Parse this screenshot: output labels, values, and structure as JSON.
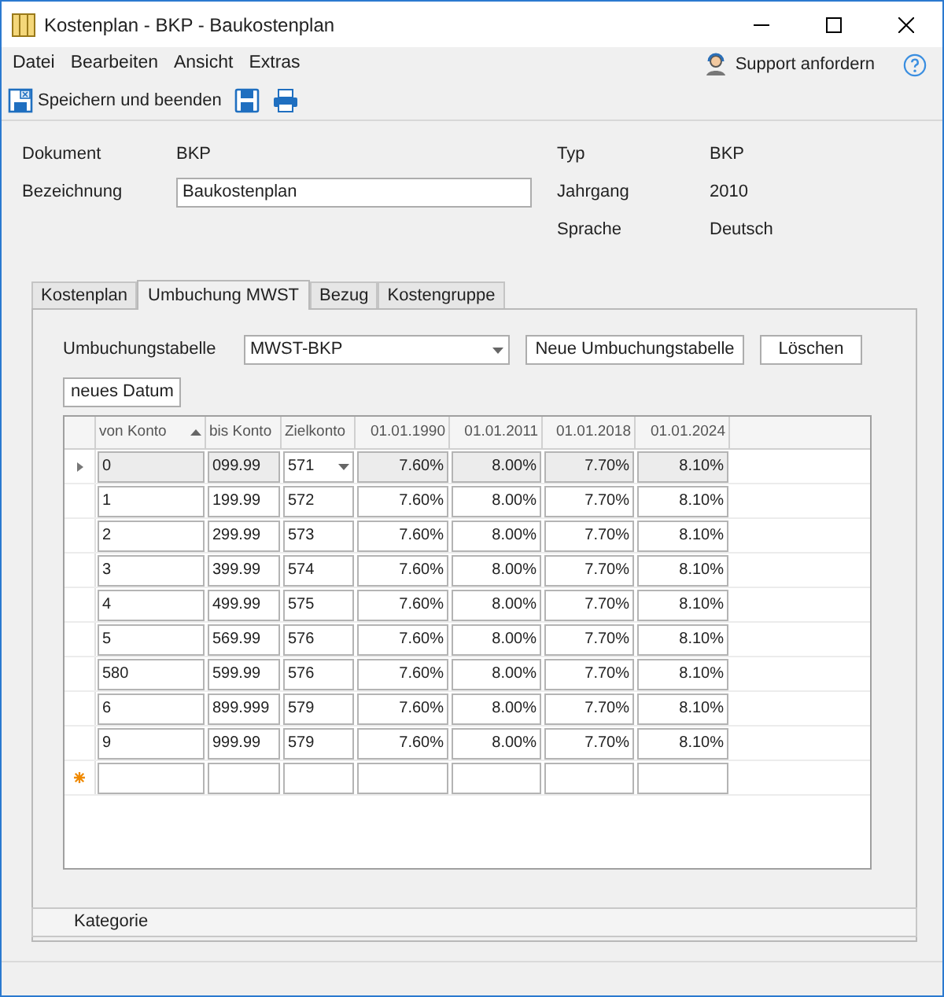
{
  "window": {
    "title": "Kostenplan - BKP - Baukostenplan"
  },
  "menu": [
    "Datei",
    "Bearbeiten",
    "Ansicht",
    "Extras"
  ],
  "support": {
    "label": "Support anfordern"
  },
  "toolbar": {
    "save_close": "Speichern und beenden"
  },
  "header_fields": {
    "left": [
      {
        "label": "Dokument",
        "value": "BKP",
        "kind": "text"
      },
      {
        "label": "Bezeichnung",
        "value": "Baukostenplan",
        "kind": "input"
      }
    ],
    "right": [
      {
        "label": "Typ",
        "value": "BKP"
      },
      {
        "label": "Jahrgang",
        "value": "2010"
      },
      {
        "label": "Sprache",
        "value": "Deutsch"
      }
    ]
  },
  "tabs": [
    {
      "label": "Kostenplan",
      "selected": false
    },
    {
      "label": "Umbuchung MWST",
      "selected": true
    },
    {
      "label": "Bezug",
      "selected": false
    },
    {
      "label": "Kostengruppe",
      "selected": false
    }
  ],
  "umbuchung": {
    "label": "Umbuchungstabelle",
    "value": "MWST-BKP",
    "buttons": [
      "Neue Umbuchungstabelle",
      "Löschen"
    ],
    "new_date": "neues Datum"
  },
  "grid": {
    "columns": [
      {
        "label": "von Konto",
        "sorted_ascending": true
      },
      {
        "label": "bis Konto",
        "sorted_ascending": false
      },
      {
        "label": "Zielkonto",
        "sorted_ascending": false
      },
      {
        "label": "01.01.1990",
        "sorted_ascending": false
      },
      {
        "label": "01.01.2011",
        "sorted_ascending": false
      },
      {
        "label": "01.01.2018",
        "sorted_ascending": false
      },
      {
        "label": "01.01.2024",
        "sorted_ascending": false
      }
    ],
    "rows": [
      {
        "kind": "data",
        "selected": true,
        "cells": [
          "0",
          "099.99",
          "571",
          "7.60%",
          "8.00%",
          "7.70%",
          "8.10%"
        ]
      },
      {
        "kind": "data",
        "selected": false,
        "cells": [
          "1",
          "199.99",
          "572",
          "7.60%",
          "8.00%",
          "7.70%",
          "8.10%"
        ]
      },
      {
        "kind": "data",
        "selected": false,
        "cells": [
          "2",
          "299.99",
          "573",
          "7.60%",
          "8.00%",
          "7.70%",
          "8.10%"
        ]
      },
      {
        "kind": "data",
        "selected": false,
        "cells": [
          "3",
          "399.99",
          "574",
          "7.60%",
          "8.00%",
          "7.70%",
          "8.10%"
        ]
      },
      {
        "kind": "data",
        "selected": false,
        "cells": [
          "4",
          "499.99",
          "575",
          "7.60%",
          "8.00%",
          "7.70%",
          "8.10%"
        ]
      },
      {
        "kind": "data",
        "selected": false,
        "cells": [
          "5",
          "569.99",
          "576",
          "7.60%",
          "8.00%",
          "7.70%",
          "8.10%"
        ]
      },
      {
        "kind": "data",
        "selected": false,
        "cells": [
          "580",
          "599.99",
          "576",
          "7.60%",
          "8.00%",
          "7.70%",
          "8.10%"
        ]
      },
      {
        "kind": "data",
        "selected": false,
        "cells": [
          "6",
          "899.999",
          "579",
          "7.60%",
          "8.00%",
          "7.70%",
          "8.10%"
        ]
      },
      {
        "kind": "data",
        "selected": false,
        "cells": [
          "9",
          "999.99",
          "579",
          "7.60%",
          "8.00%",
          "7.70%",
          "8.10%"
        ]
      },
      {
        "kind": "new",
        "selected": false
      }
    ]
  },
  "category_bar": {
    "label": "Kategorie"
  }
}
